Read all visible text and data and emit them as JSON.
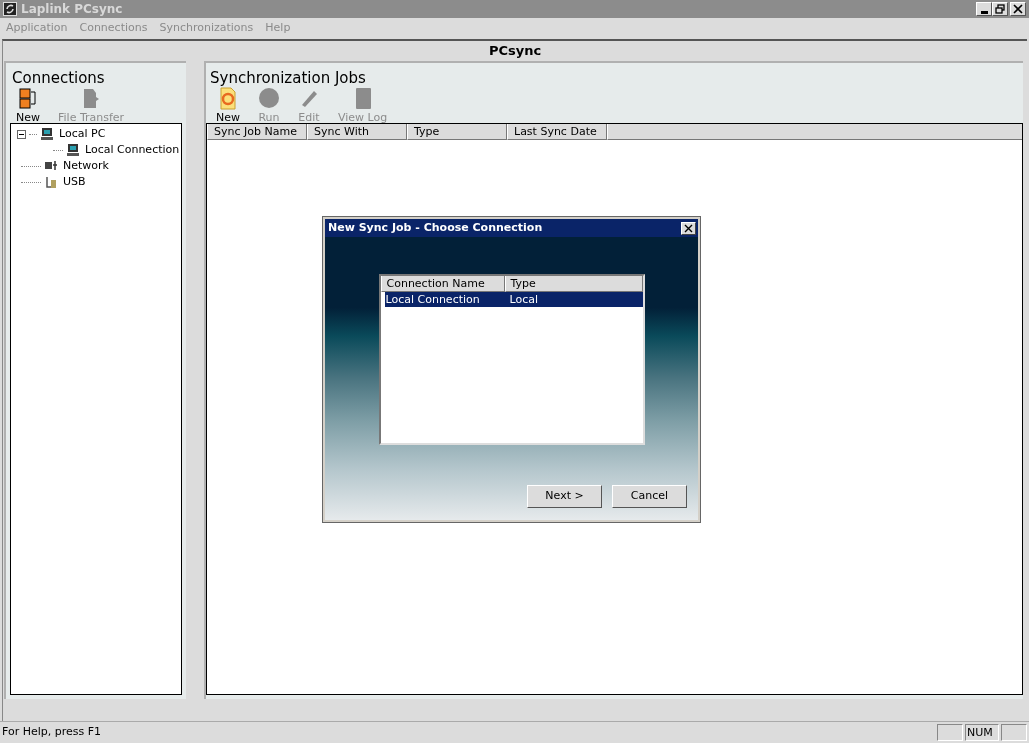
{
  "window": {
    "title": "Laplink PCsync"
  },
  "menu": [
    {
      "label": "Application",
      "disabled": true
    },
    {
      "label": "Connections",
      "disabled": true
    },
    {
      "label": "Synchronizations",
      "disabled": true
    },
    {
      "label": "Help",
      "disabled": true
    }
  ],
  "header": "PCsync",
  "connections": {
    "title": "Connections",
    "toolbar": [
      {
        "label": "New",
        "kind": "new-connection",
        "disabled": false
      },
      {
        "label": "File Transfer",
        "kind": "file-transfer",
        "disabled": true
      }
    ],
    "tree": [
      {
        "label": "Local PC",
        "kind": "pc",
        "expanded": true,
        "children": [
          {
            "label": "Local Connection",
            "kind": "pc"
          }
        ]
      },
      {
        "label": "Network",
        "kind": "network"
      },
      {
        "label": "USB",
        "kind": "usb"
      }
    ]
  },
  "jobs": {
    "title": "Synchronization Jobs",
    "toolbar": [
      {
        "label": "New",
        "kind": "new-job",
        "disabled": false
      },
      {
        "label": "Run",
        "kind": "run",
        "disabled": true
      },
      {
        "label": "Edit",
        "kind": "edit",
        "disabled": true
      },
      {
        "label": "View Log",
        "kind": "log",
        "disabled": true
      }
    ],
    "columns": [
      "Sync Job Name",
      "Sync With",
      "Type",
      "Last Sync Date"
    ]
  },
  "dialog": {
    "title": "New Sync Job - Choose Connection",
    "columns": [
      "Connection Name",
      "Type"
    ],
    "rows": [
      {
        "cells": [
          "Local Connection",
          "Local"
        ],
        "selected": true
      }
    ],
    "buttons": [
      "Next >",
      "Cancel"
    ]
  },
  "status_bar": {
    "text": "For Help, press F1",
    "indicators": [
      "NUM"
    ]
  }
}
